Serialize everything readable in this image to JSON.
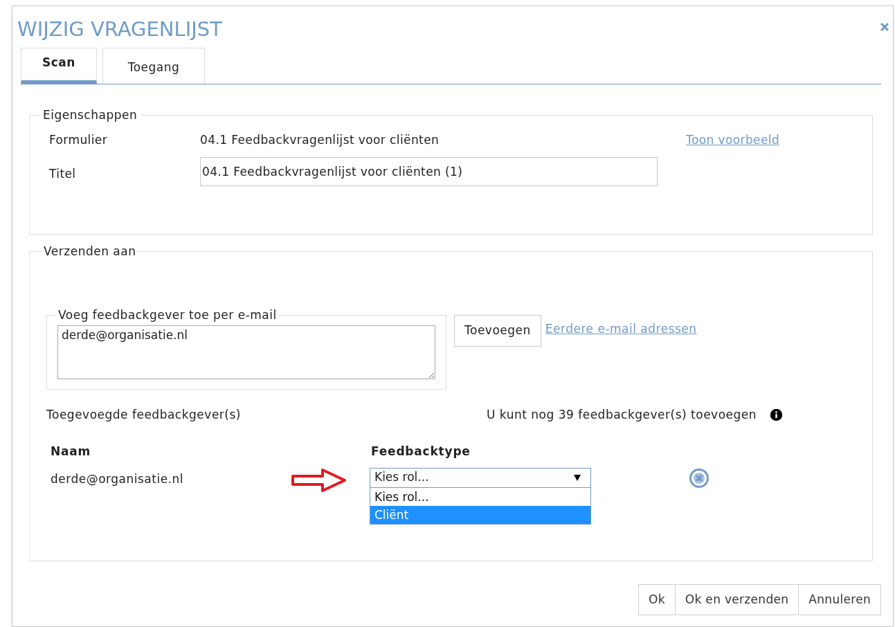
{
  "dialog": {
    "title": "WIJZIG VRAGENLIJST"
  },
  "tabs": [
    {
      "label": "Scan",
      "selected": true
    },
    {
      "label": "Toegang",
      "selected": false
    }
  ],
  "properties": {
    "legend": "Eigenschappen",
    "form_label": "Formulier",
    "form_value": "04.1 Feedbackvragenlijst voor cliënten",
    "preview_link": "Toon voorbeeld",
    "title_label": "Titel",
    "title_value": "04.1 Feedbackvragenlijst voor cliënten (1)"
  },
  "send_to": {
    "legend": "Verzenden aan",
    "email_legend": "Voeg feedbackgever toe per e-mail",
    "email_value": "derde@organisatie.nl",
    "add_button": "Toevoegen",
    "previous_link": "Eerdere e-mail adressen",
    "added_label": "Toegevoegde feedbackgever(s)",
    "remaining": "U kunt nog 39 feedbackgever(s) toevoegen",
    "columns": [
      "Naam",
      "Feedbacktype"
    ],
    "rows": [
      {
        "name": "derde@organisatie.nl",
        "role": "Kies rol...",
        "expanded": true,
        "options": [
          {
            "label": "Kies rol...",
            "selected": false
          },
          {
            "label": "Cliënt",
            "selected": true
          }
        ]
      }
    ]
  },
  "buttons": [
    "Ok",
    "Ok en verzenden",
    "Annuleren"
  ]
}
